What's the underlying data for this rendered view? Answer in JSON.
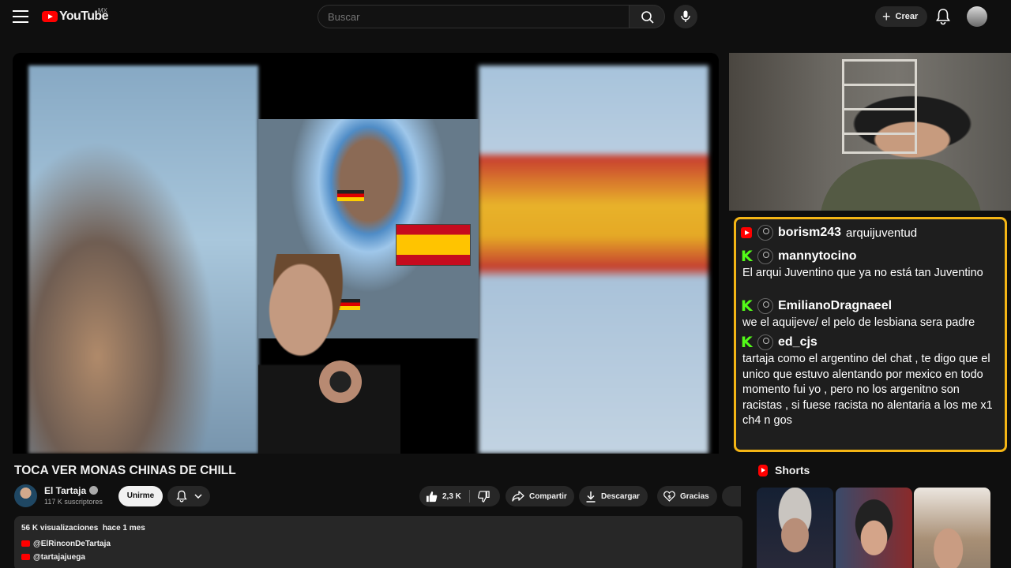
{
  "header": {
    "logo_text": "YouTube",
    "region": "MX",
    "search_placeholder": "Buscar",
    "create_label": "Crear"
  },
  "video": {
    "title": "TOCA VER MONAS CHINAS DE CHILL"
  },
  "channel": {
    "name": "El Tartaja",
    "subscribers": "117 K suscriptores",
    "join_label": "Unirme"
  },
  "actions": {
    "likes": "2,3 K",
    "share_label": "Compartir",
    "download_label": "Descargar",
    "thanks_label": "Gracias"
  },
  "description": {
    "views": "56 K visualizaciones",
    "age": "hace 1 mes",
    "links": [
      "@ElRinconDeTartaja",
      "@tartajajuega"
    ]
  },
  "chat": {
    "messages": [
      {
        "platform": "youtube",
        "user": "borism243",
        "text": "arquijuventud"
      },
      {
        "platform": "kick",
        "user": "mannytocino",
        "text": "El arqui Juventino que ya no está tan Juventino"
      },
      {
        "platform": "kick",
        "user": "EmilianoDragnaeel",
        "text": "we el aquijeve/ el pelo de lesbiana sera padre"
      },
      {
        "platform": "kick",
        "user": "ed_cjs",
        "text": "tartaja como el argentino del chat , te digo que el unico que estuvo alentando por mexico en todo momento fui yo , pero no los argenitno son racistas , si fuese racista no alentaria a los me x1 ch4 n gos"
      }
    ]
  },
  "shorts": {
    "heading": "Shorts"
  },
  "colors": {
    "brand_red": "#ff0000",
    "chat_border": "#f4b515",
    "kick_green": "#53fc18"
  }
}
